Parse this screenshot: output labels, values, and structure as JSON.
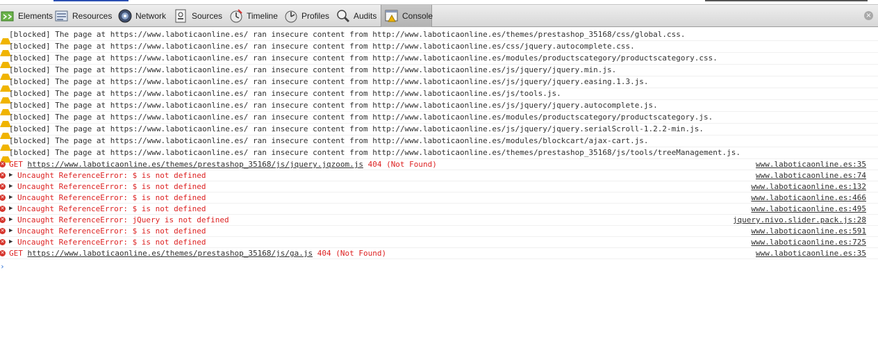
{
  "toolbar": {
    "tabs": [
      {
        "label": "Elements",
        "icon": "elements-icon"
      },
      {
        "label": "Resources",
        "icon": "resources-icon"
      },
      {
        "label": "Network",
        "icon": "network-icon"
      },
      {
        "label": "Sources",
        "icon": "sources-icon"
      },
      {
        "label": "Timeline",
        "icon": "timeline-icon"
      },
      {
        "label": "Profiles",
        "icon": "profiles-icon"
      },
      {
        "label": "Audits",
        "icon": "audits-icon"
      },
      {
        "label": "Console",
        "icon": "console-icon",
        "selected": true
      }
    ],
    "close_glyph": "×"
  },
  "console": {
    "warnings": [
      {
        "prefix": "[blocked] The page at ",
        "page": "https://www.laboticaonline.es/",
        "mid": " ran insecure content from ",
        "url": "http://www.laboticaonline.es/themes/prestashop_35168/css/global.css."
      },
      {
        "prefix": "[blocked] The page at ",
        "page": "https://www.laboticaonline.es/",
        "mid": " ran insecure content from ",
        "url": "http://www.laboticaonline.es/css/jquery.autocomplete.css."
      },
      {
        "prefix": "[blocked] The page at ",
        "page": "https://www.laboticaonline.es/",
        "mid": " ran insecure content from ",
        "url": "http://www.laboticaonline.es/modules/productscategory/productscategory.css."
      },
      {
        "prefix": "[blocked] The page at ",
        "page": "https://www.laboticaonline.es/",
        "mid": " ran insecure content from ",
        "url": "http://www.laboticaonline.es/js/jquery/jquery.min.js."
      },
      {
        "prefix": "[blocked] The page at ",
        "page": "https://www.laboticaonline.es/",
        "mid": " ran insecure content from ",
        "url": "http://www.laboticaonline.es/js/jquery/jquery.easing.1.3.js."
      },
      {
        "prefix": "[blocked] The page at ",
        "page": "https://www.laboticaonline.es/",
        "mid": " ran insecure content from ",
        "url": "http://www.laboticaonline.es/js/tools.js."
      },
      {
        "prefix": "[blocked] The page at ",
        "page": "https://www.laboticaonline.es/",
        "mid": " ran insecure content from ",
        "url": "http://www.laboticaonline.es/js/jquery/jquery.autocomplete.js."
      },
      {
        "prefix": "[blocked] The page at ",
        "page": "https://www.laboticaonline.es/",
        "mid": " ran insecure content from ",
        "url": "http://www.laboticaonline.es/modules/productscategory/productscategory.js."
      },
      {
        "prefix": "[blocked] The page at ",
        "page": "https://www.laboticaonline.es/",
        "mid": " ran insecure content from ",
        "url": "http://www.laboticaonline.es/js/jquery/jquery.serialScroll-1.2.2-min.js."
      },
      {
        "prefix": "[blocked] The page at ",
        "page": "https://www.laboticaonline.es/",
        "mid": " ran insecure content from ",
        "url": "http://www.laboticaonline.es/modules/blockcart/ajax-cart.js."
      },
      {
        "prefix": "[blocked] The page at ",
        "page": "https://www.laboticaonline.es/",
        "mid": " ran insecure content from ",
        "url": "http://www.laboticaonline.es/themes/prestashop_35168/js/tools/treeManagement.js."
      }
    ],
    "errors": [
      {
        "kind": "get",
        "method": "GET ",
        "url": "https://www.laboticaonline.es/themes/prestashop_35168/js/jquery.jqzoom.js",
        "status": " 404 (Not Found)",
        "source": "www.laboticaonline.es:35"
      },
      {
        "kind": "exc",
        "text": "Uncaught ReferenceError: $ is not defined",
        "source": "www.laboticaonline.es:74"
      },
      {
        "kind": "exc",
        "text": "Uncaught ReferenceError: $ is not defined",
        "source": "www.laboticaonline.es:132"
      },
      {
        "kind": "exc",
        "text": "Uncaught ReferenceError: $ is not defined",
        "source": "www.laboticaonline.es:466"
      },
      {
        "kind": "exc",
        "text": "Uncaught ReferenceError: $ is not defined",
        "source": "www.laboticaonline.es:495"
      },
      {
        "kind": "exc",
        "text": "Uncaught ReferenceError: jQuery is not defined",
        "source": "jquery.nivo.slider.pack.js:28"
      },
      {
        "kind": "exc",
        "text": "Uncaught ReferenceError: $ is not defined",
        "source": "www.laboticaonline.es:591"
      },
      {
        "kind": "exc",
        "text": "Uncaught ReferenceError: $ is not defined",
        "source": "www.laboticaonline.es:725"
      },
      {
        "kind": "get",
        "method": "GET ",
        "url": "https://www.laboticaonline.es/themes/prestashop_35168/js/ga.js",
        "status": " 404 (Not Found)",
        "source": "www.laboticaonline.es:35"
      }
    ],
    "prompt_glyph": "›"
  },
  "colors": {
    "warning": "#f0b400",
    "error": "#d22222",
    "error_icon": "#d6342b",
    "prompt": "#2b6fd6"
  }
}
